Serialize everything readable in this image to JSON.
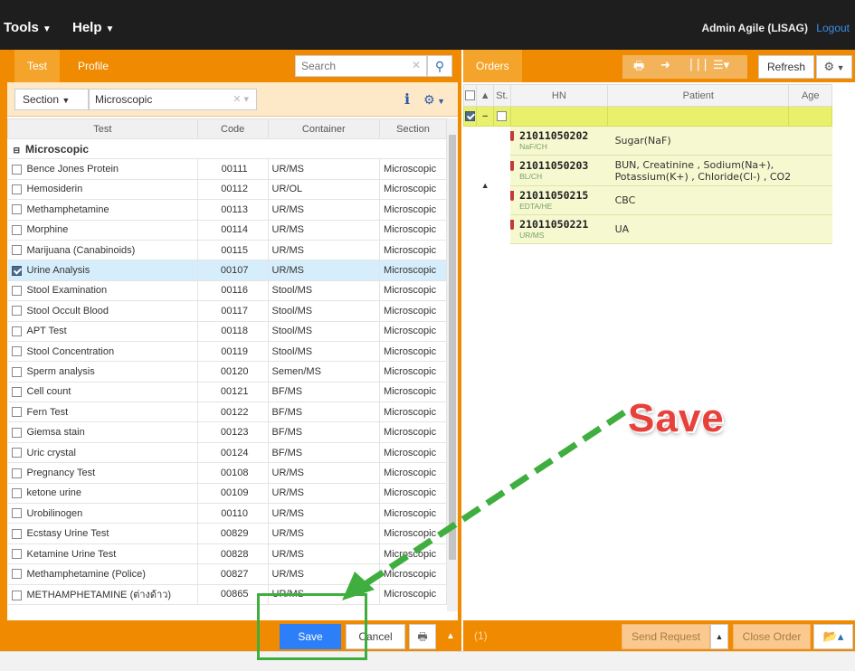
{
  "topbar": {
    "menus": [
      {
        "label": "Tools"
      },
      {
        "label": "Help"
      }
    ],
    "user": "Admin Agile (LISAG)",
    "logout": "Logout"
  },
  "left": {
    "tabs": [
      "Test",
      "Profile"
    ],
    "search_placeholder": "Search",
    "section_label": "Section",
    "section_value": "Microscopic",
    "columns": [
      "Test",
      "Code",
      "Container",
      "Section"
    ],
    "group": "Microscopic",
    "rows": [
      {
        "test": "Bence Jones Protein",
        "code": "00111",
        "container": "UR/MS",
        "section": "Microscopic",
        "checked": false
      },
      {
        "test": "Hemosiderin",
        "code": "00112",
        "container": "UR/OL",
        "section": "Microscopic",
        "checked": false
      },
      {
        "test": "Methamphetamine",
        "code": "00113",
        "container": "UR/MS",
        "section": "Microscopic",
        "checked": false
      },
      {
        "test": "Morphine",
        "code": "00114",
        "container": "UR/MS",
        "section": "Microscopic",
        "checked": false
      },
      {
        "test": "Marijuana (Canabinoids)",
        "code": "00115",
        "container": "UR/MS",
        "section": "Microscopic",
        "checked": false
      },
      {
        "test": "Urine Analysis",
        "code": "00107",
        "container": "UR/MS",
        "section": "Microscopic",
        "checked": true
      },
      {
        "test": "Stool Examination",
        "code": "00116",
        "container": "Stool/MS",
        "section": "Microscopic",
        "checked": false
      },
      {
        "test": "Stool Occult Blood",
        "code": "00117",
        "container": "Stool/MS",
        "section": "Microscopic",
        "checked": false
      },
      {
        "test": "APT Test",
        "code": "00118",
        "container": "Stool/MS",
        "section": "Microscopic",
        "checked": false
      },
      {
        "test": "Stool Concentration",
        "code": "00119",
        "container": "Stool/MS",
        "section": "Microscopic",
        "checked": false
      },
      {
        "test": "Sperm analysis",
        "code": "00120",
        "container": "Semen/MS",
        "section": "Microscopic",
        "checked": false
      },
      {
        "test": "Cell count",
        "code": "00121",
        "container": "BF/MS",
        "section": "Microscopic",
        "checked": false
      },
      {
        "test": "Fern Test",
        "code": "00122",
        "container": "BF/MS",
        "section": "Microscopic",
        "checked": false
      },
      {
        "test": "Giemsa stain",
        "code": "00123",
        "container": "BF/MS",
        "section": "Microscopic",
        "checked": false
      },
      {
        "test": "Uric crystal",
        "code": "00124",
        "container": "BF/MS",
        "section": "Microscopic",
        "checked": false
      },
      {
        "test": "Pregnancy Test",
        "code": "00108",
        "container": "UR/MS",
        "section": "Microscopic",
        "checked": false
      },
      {
        "test": "ketone urine",
        "code": "00109",
        "container": "UR/MS",
        "section": "Microscopic",
        "checked": false
      },
      {
        "test": "Urobilinogen",
        "code": "00110",
        "container": "UR/MS",
        "section": "Microscopic",
        "checked": false
      },
      {
        "test": "Ecstasy Urine Test",
        "code": "00829",
        "container": "UR/MS",
        "section": "Microscopic",
        "checked": false
      },
      {
        "test": "Ketamine Urine Test",
        "code": "00828",
        "container": "UR/MS",
        "section": "Microscopic",
        "checked": false
      },
      {
        "test": "Methamphetamine (Police)",
        "code": "00827",
        "container": "UR/MS",
        "section": "Microscopic",
        "checked": false
      },
      {
        "test": "METHAMPHETAMINE (ต่างด้าว)",
        "code": "00865",
        "container": "UR/MS",
        "section": "Microscopic",
        "checked": false
      }
    ],
    "save": "Save",
    "cancel": "Cancel"
  },
  "right": {
    "tabs": [
      "Orders"
    ],
    "refresh": "Refresh",
    "columns": [
      "St.",
      "HN",
      "Patient",
      "Age"
    ],
    "orders": [
      {
        "hn": "21011050202",
        "container": "NaF/CH",
        "patient": "Sugar(NaF)"
      },
      {
        "hn": "21011050203",
        "container": "BL/CH",
        "patient": "BUN, Creatinine , Sodium(Na+), Potassium(K+) , Chloride(Cl-) , CO2"
      },
      {
        "hn": "21011050215",
        "container": "EDTA/HE",
        "patient": "CBC"
      },
      {
        "hn": "21011050221",
        "container": "UR/MS",
        "patient": "UA"
      }
    ],
    "count": "(1)",
    "send_request": "Send Request",
    "close_order": "Close Order"
  },
  "annotation": {
    "label": "Save",
    "colors": {
      "text": "#e8403a",
      "arrow": "#3fae3f"
    }
  },
  "colors": {
    "accent": "#f08a00",
    "primary": "#2d7ff9",
    "selected_row": "#d6eefb",
    "order_row": "#f6f8cf"
  }
}
